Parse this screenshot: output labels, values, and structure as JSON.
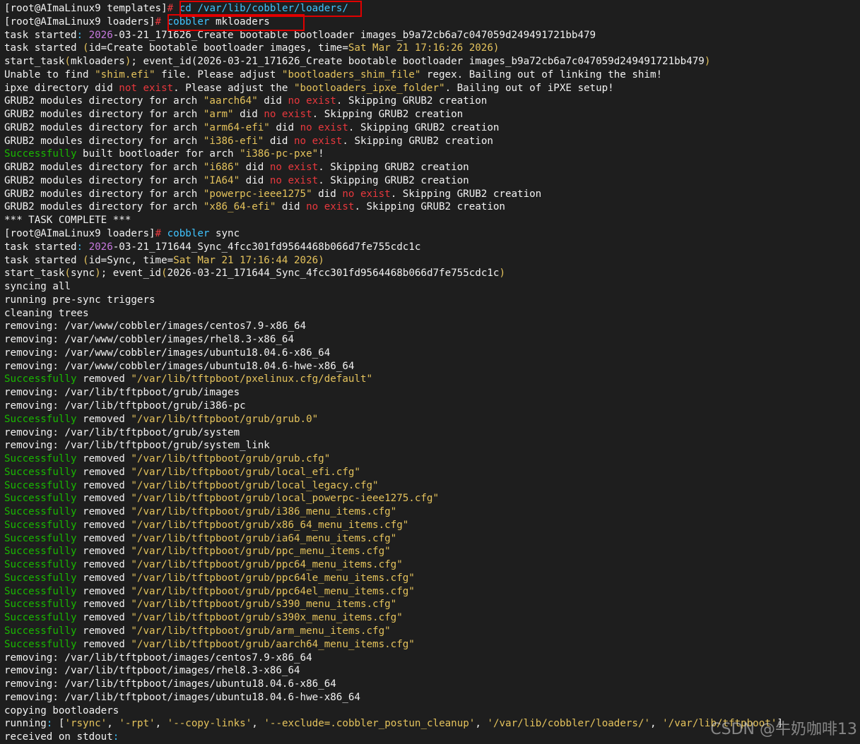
{
  "colors": {
    "background": "#1e1e1e",
    "text": "#f2f2f2",
    "success_green": "#19b800",
    "error_red": "#e8383d",
    "string_yellow": "#e5c35c",
    "command_cyan": "#40c4ff",
    "highlight_box": "#e00000"
  },
  "watermark": "CSDN @牛奶咖啡13",
  "lines": [
    [
      [
        "w",
        "[root@AImaLinux9 templates]"
      ],
      [
        "r",
        "# "
      ],
      [
        "c",
        "cd"
      ],
      [
        "w",
        " "
      ],
      [
        "c",
        "/var/lib/cobbler/loaders/"
      ]
    ],
    [
      [
        "w",
        "[root@AImaLinux9 loaders]"
      ],
      [
        "r",
        "# "
      ],
      [
        "c",
        "cobbler"
      ],
      [
        "w",
        " mkloaders"
      ]
    ],
    [
      [
        "w",
        "task started"
      ],
      [
        "c",
        ": "
      ],
      [
        "m",
        "2026"
      ],
      [
        "w",
        "-03-21_171626_Create bootable bootloader images_b9a72cb6a7c047059d249491721bb479"
      ]
    ],
    [
      [
        "w",
        "task started "
      ],
      [
        "y",
        "("
      ],
      [
        "w",
        "id=Create bootable bootloader images, time="
      ],
      [
        "y",
        "Sat Mar 21 17:16:26 2026"
      ],
      [
        "y",
        ")"
      ]
    ],
    [
      [
        "w",
        "start_task"
      ],
      [
        "y",
        "("
      ],
      [
        "w",
        "mkloaders"
      ],
      [
        "y",
        ")"
      ],
      [
        "w",
        "; event_id(2026-03-21_171626_Create bootable bootloader images_b9a72cb6a7c047059d249491721bb479"
      ],
      [
        "y",
        ")"
      ]
    ],
    [
      [
        "w",
        "Unable to find "
      ],
      [
        "y",
        "\"shim.efi\""
      ],
      [
        "w",
        " file. Please adjust "
      ],
      [
        "y",
        "\"bootloaders_shim_file\""
      ],
      [
        "w",
        " regex. Bailing out of linking the shim!"
      ]
    ],
    [
      [
        "w",
        "ipxe directory did "
      ],
      [
        "r",
        "not exist"
      ],
      [
        "w",
        ". Please adjust the "
      ],
      [
        "y",
        "\"bootloaders_ipxe_folder\""
      ],
      [
        "w",
        ". Bailing out of iPXE setup!"
      ]
    ],
    [
      [
        "w",
        "GRUB2 modules directory for arch "
      ],
      [
        "y",
        "\"aarch64\""
      ],
      [
        "w",
        " did "
      ],
      [
        "r",
        "no exist"
      ],
      [
        "w",
        ". Skipping GRUB2 creation"
      ]
    ],
    [
      [
        "w",
        "GRUB2 modules directory for arch "
      ],
      [
        "y",
        "\"arm\""
      ],
      [
        "w",
        " did "
      ],
      [
        "r",
        "no exist"
      ],
      [
        "w",
        ". Skipping GRUB2 creation"
      ]
    ],
    [
      [
        "w",
        "GRUB2 modules directory for arch "
      ],
      [
        "y",
        "\"arm64-efi\""
      ],
      [
        "w",
        " did "
      ],
      [
        "r",
        "no exist"
      ],
      [
        "w",
        ". Skipping GRUB2 creation"
      ]
    ],
    [
      [
        "w",
        "GRUB2 modules directory for arch "
      ],
      [
        "y",
        "\"i386-efi\""
      ],
      [
        "w",
        " did "
      ],
      [
        "r",
        "no exist"
      ],
      [
        "w",
        ". Skipping GRUB2 creation"
      ]
    ],
    [
      [
        "g",
        "Successfully"
      ],
      [
        "w",
        " built bootloader for arch "
      ],
      [
        "y",
        "\"i386-pc-pxe\""
      ],
      [
        "w",
        "!"
      ]
    ],
    [
      [
        "w",
        "GRUB2 modules directory for arch "
      ],
      [
        "y",
        "\"i686\""
      ],
      [
        "w",
        " did "
      ],
      [
        "r",
        "no exist"
      ],
      [
        "w",
        ". Skipping GRUB2 creation"
      ]
    ],
    [
      [
        "w",
        "GRUB2 modules directory for arch "
      ],
      [
        "y",
        "\"IA64\""
      ],
      [
        "w",
        " did "
      ],
      [
        "r",
        "no exist"
      ],
      [
        "w",
        ". Skipping GRUB2 creation"
      ]
    ],
    [
      [
        "w",
        "GRUB2 modules directory for arch "
      ],
      [
        "y",
        "\"powerpc-ieee1275\""
      ],
      [
        "w",
        " did "
      ],
      [
        "r",
        "no exist"
      ],
      [
        "w",
        ". Skipping GRUB2 creation"
      ]
    ],
    [
      [
        "w",
        "GRUB2 modules directory for arch "
      ],
      [
        "y",
        "\"x86_64-efi\""
      ],
      [
        "w",
        " did "
      ],
      [
        "r",
        "no exist"
      ],
      [
        "w",
        ". Skipping GRUB2 creation"
      ]
    ],
    [
      [
        "w",
        "*** TASK COMPLETE ***"
      ]
    ],
    [
      [
        "w",
        "[root@AImaLinux9 loaders]"
      ],
      [
        "r",
        "# "
      ],
      [
        "c",
        "cobbler"
      ],
      [
        "w",
        " sync"
      ]
    ],
    [
      [
        "w",
        "task started"
      ],
      [
        "c",
        ": "
      ],
      [
        "m",
        "2026"
      ],
      [
        "w",
        "-03-21_171644_Sync_4fcc301fd9564468b066d7fe755cdc1c"
      ]
    ],
    [
      [
        "w",
        "task started "
      ],
      [
        "y",
        "("
      ],
      [
        "w",
        "id=Sync, time="
      ],
      [
        "y",
        "Sat Mar 21 17:16:44 2026"
      ],
      [
        "y",
        ")"
      ]
    ],
    [
      [
        "w",
        "start_task"
      ],
      [
        "y",
        "("
      ],
      [
        "w",
        "sync"
      ],
      [
        "y",
        ")"
      ],
      [
        "w",
        "; event_id"
      ],
      [
        "y",
        "("
      ],
      [
        "w",
        "2026-03-21_171644_Sync_4fcc301fd9564468b066d7fe755cdc1c"
      ],
      [
        "y",
        ")"
      ]
    ],
    [
      [
        "w",
        "syncing all"
      ]
    ],
    [
      [
        "w",
        "running pre-sync triggers"
      ]
    ],
    [
      [
        "w",
        "cleaning trees"
      ]
    ],
    [
      [
        "w",
        "removing: /var/www/cobbler/images/centos7.9-x86_64"
      ]
    ],
    [
      [
        "w",
        "removing: /var/www/cobbler/images/rhel8.3-x86_64"
      ]
    ],
    [
      [
        "w",
        "removing: /var/www/cobbler/images/ubuntu18.04.6-x86_64"
      ]
    ],
    [
      [
        "w",
        "removing: /var/www/cobbler/images/ubuntu18.04.6-hwe-x86_64"
      ]
    ],
    [
      [
        "g",
        "Successfully"
      ],
      [
        "w",
        " removed "
      ],
      [
        "y",
        "\"/var/lib/tftpboot/pxelinux.cfg/default\""
      ]
    ],
    [
      [
        "w",
        "removing: /var/lib/tftpboot/grub/images"
      ]
    ],
    [
      [
        "w",
        "removing: /var/lib/tftpboot/grub/i386-pc"
      ]
    ],
    [
      [
        "g",
        "Successfully"
      ],
      [
        "w",
        " removed "
      ],
      [
        "y",
        "\"/var/lib/tftpboot/grub/grub.0\""
      ]
    ],
    [
      [
        "w",
        "removing: /var/lib/tftpboot/grub/system"
      ]
    ],
    [
      [
        "w",
        "removing: /var/lib/tftpboot/grub/system_link"
      ]
    ],
    [
      [
        "g",
        "Successfully"
      ],
      [
        "w",
        " removed "
      ],
      [
        "y",
        "\"/var/lib/tftpboot/grub/grub.cfg\""
      ]
    ],
    [
      [
        "g",
        "Successfully"
      ],
      [
        "w",
        " removed "
      ],
      [
        "y",
        "\"/var/lib/tftpboot/grub/local_efi.cfg\""
      ]
    ],
    [
      [
        "g",
        "Successfully"
      ],
      [
        "w",
        " removed "
      ],
      [
        "y",
        "\"/var/lib/tftpboot/grub/local_legacy.cfg\""
      ]
    ],
    [
      [
        "g",
        "Successfully"
      ],
      [
        "w",
        " removed "
      ],
      [
        "y",
        "\"/var/lib/tftpboot/grub/local_powerpc-ieee1275.cfg\""
      ]
    ],
    [
      [
        "g",
        "Successfully"
      ],
      [
        "w",
        " removed "
      ],
      [
        "y",
        "\"/var/lib/tftpboot/grub/i386_menu_items.cfg\""
      ]
    ],
    [
      [
        "g",
        "Successfully"
      ],
      [
        "w",
        " removed "
      ],
      [
        "y",
        "\"/var/lib/tftpboot/grub/x86_64_menu_items.cfg\""
      ]
    ],
    [
      [
        "g",
        "Successfully"
      ],
      [
        "w",
        " removed "
      ],
      [
        "y",
        "\"/var/lib/tftpboot/grub/ia64_menu_items.cfg\""
      ]
    ],
    [
      [
        "g",
        "Successfully"
      ],
      [
        "w",
        " removed "
      ],
      [
        "y",
        "\"/var/lib/tftpboot/grub/ppc_menu_items.cfg\""
      ]
    ],
    [
      [
        "g",
        "Successfully"
      ],
      [
        "w",
        " removed "
      ],
      [
        "y",
        "\"/var/lib/tftpboot/grub/ppc64_menu_items.cfg\""
      ]
    ],
    [
      [
        "g",
        "Successfully"
      ],
      [
        "w",
        " removed "
      ],
      [
        "y",
        "\"/var/lib/tftpboot/grub/ppc64le_menu_items.cfg\""
      ]
    ],
    [
      [
        "g",
        "Successfully"
      ],
      [
        "w",
        " removed "
      ],
      [
        "y",
        "\"/var/lib/tftpboot/grub/ppc64el_menu_items.cfg\""
      ]
    ],
    [
      [
        "g",
        "Successfully"
      ],
      [
        "w",
        " removed "
      ],
      [
        "y",
        "\"/var/lib/tftpboot/grub/s390_menu_items.cfg\""
      ]
    ],
    [
      [
        "g",
        "Successfully"
      ],
      [
        "w",
        " removed "
      ],
      [
        "y",
        "\"/var/lib/tftpboot/grub/s390x_menu_items.cfg\""
      ]
    ],
    [
      [
        "g",
        "Successfully"
      ],
      [
        "w",
        " removed "
      ],
      [
        "y",
        "\"/var/lib/tftpboot/grub/arm_menu_items.cfg\""
      ]
    ],
    [
      [
        "g",
        "Successfully"
      ],
      [
        "w",
        " removed "
      ],
      [
        "y",
        "\"/var/lib/tftpboot/grub/aarch64_menu_items.cfg\""
      ]
    ],
    [
      [
        "w",
        "removing: /var/lib/tftpboot/images/centos7.9-x86_64"
      ]
    ],
    [
      [
        "w",
        "removing: /var/lib/tftpboot/images/rhel8.3-x86_64"
      ]
    ],
    [
      [
        "w",
        "removing: /var/lib/tftpboot/images/ubuntu18.04.6-x86_64"
      ]
    ],
    [
      [
        "w",
        "removing: /var/lib/tftpboot/images/ubuntu18.04.6-hwe-x86_64"
      ]
    ],
    [
      [
        "w",
        "copying bootloaders"
      ]
    ],
    [
      [
        "w",
        "running"
      ],
      [
        "c",
        ": "
      ],
      [
        "w",
        "["
      ],
      [
        "y",
        "'rsync'"
      ],
      [
        "w",
        ", "
      ],
      [
        "y",
        "'-rpt'"
      ],
      [
        "w",
        ", "
      ],
      [
        "y",
        "'--copy-links'"
      ],
      [
        "w",
        ", "
      ],
      [
        "y",
        "'--exclude=.cobbler_postun_cleanup'"
      ],
      [
        "w",
        ", "
      ],
      [
        "y",
        "'/var/lib/cobbler/loaders/'"
      ],
      [
        "w",
        ", "
      ],
      [
        "y",
        "'/var/lib/tftpboot'"
      ],
      [
        "w",
        "]"
      ]
    ],
    [
      [
        "w",
        "received on stdout"
      ],
      [
        "c",
        ":"
      ]
    ]
  ]
}
